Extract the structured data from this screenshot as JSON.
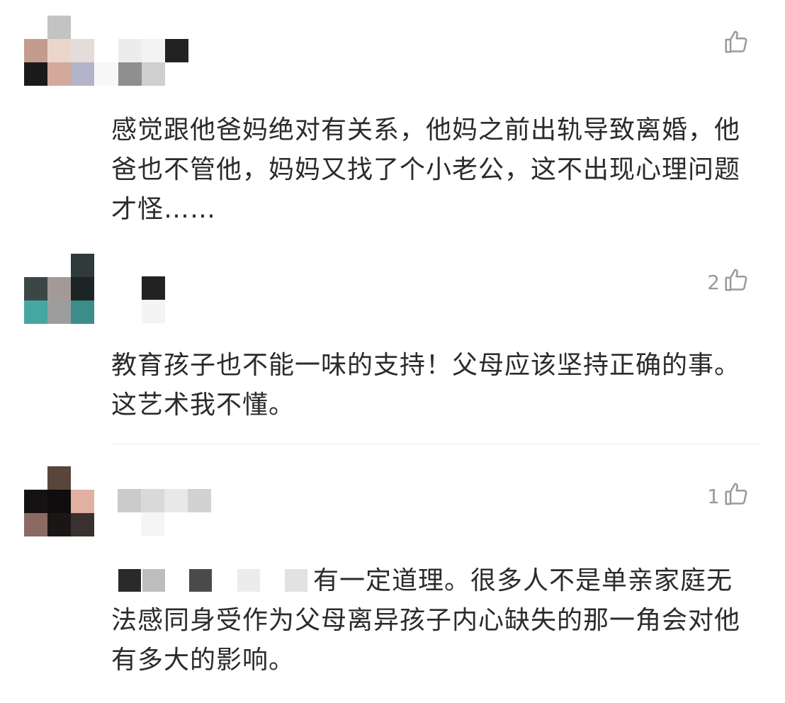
{
  "comments": [
    {
      "likes": "",
      "text": "感觉跟他爸妈绝对有关系，他妈之前出轨导致离婚，他爸也不管他，妈妈又找了个小老公，这不出现心理问题才怪……"
    },
    {
      "likes": "2",
      "text": "教育孩子也不能一味的支持！父母应该坚持正确的事。这艺术我不懂。"
    },
    {
      "likes": "1",
      "text": "有一定道理。很多人不是单亲家庭无法感同身受作为父母离异孩子内心缺失的那一角会对他有多大的影响。"
    }
  ],
  "icons": {
    "like": "thumbs-up-icon"
  },
  "colors": {
    "text": "#2b2b2b",
    "muted": "#9a9a9a",
    "divider": "#e6e6e6"
  }
}
